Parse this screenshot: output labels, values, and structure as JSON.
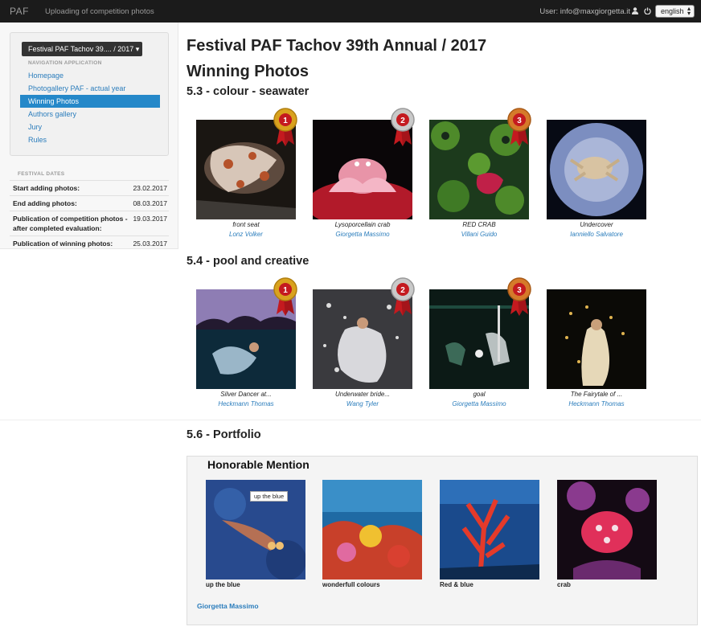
{
  "topbar": {
    "brand": "PAF",
    "app_title": "Uploading of competition photos",
    "user": "User: info@maxgiorgetta.it",
    "language": "english"
  },
  "nav": {
    "festival_button": "Festival PAF Tachov 39.... / 2017 ▾",
    "header": "NAVIGATION APPLICATION",
    "items": [
      {
        "label": "Homepage",
        "active": false
      },
      {
        "label": "Photogallery PAF - actual year",
        "active": false
      },
      {
        "label": "Winning Photos",
        "active": true
      },
      {
        "label": "Authors gallery",
        "active": false
      },
      {
        "label": "Jury",
        "active": false
      },
      {
        "label": "Rules",
        "active": false
      }
    ]
  },
  "dates": {
    "title": "FESTIVAL DATES",
    "rows": [
      {
        "label": "Start adding photos:",
        "value": "23.02.2017"
      },
      {
        "label": "End adding photos:",
        "value": "08.03.2017"
      },
      {
        "label": "Publication of competition photos - after completed evaluation:",
        "value": "19.03.2017"
      },
      {
        "label": "Publication of winning photos:",
        "value": "25.03.2017"
      }
    ]
  },
  "main": {
    "title": "Festival PAF Tachov 39th Annual / 2017",
    "subtitle": "Winning Photos",
    "sections": [
      {
        "heading": "5.3 - colour - seawater",
        "photos": [
          {
            "caption": "front seat",
            "author": "Lonz Volker",
            "medal": "1"
          },
          {
            "caption": "Lysoporcellain crab",
            "author": "Giorgetta Massimo",
            "medal": "2"
          },
          {
            "caption": "RED CRAB",
            "author": "Villani Guido",
            "medal": "3"
          },
          {
            "caption": "Undercover",
            "author": "Ianniello Salvatore",
            "medal": ""
          }
        ]
      },
      {
        "heading": "5.4 - pool and creative",
        "photos": [
          {
            "caption": "Silver Dancer at...",
            "author": "Heckmann Thomas",
            "medal": "1"
          },
          {
            "caption": "Underwater bride...",
            "author": "Wang Tyler",
            "medal": "2"
          },
          {
            "caption": "goal",
            "author": "Giorgetta Massimo",
            "medal": "3"
          },
          {
            "caption": "The Fairytale of ...",
            "author": "Heckmann Thomas",
            "medal": ""
          }
        ]
      }
    ],
    "portfolio": {
      "heading": "5.6 - Portfolio",
      "box_title": "Honorable Mention",
      "tooltip": "up the blue",
      "photos": [
        {
          "caption": "up the blue"
        },
        {
          "caption": "wonderfull colours"
        },
        {
          "caption": "Red & blue"
        },
        {
          "caption": "crab"
        }
      ],
      "author": "Giorgetta Massimo"
    }
  },
  "colors": {
    "link": "#2b7dbc",
    "nav_active": "#2588c9",
    "topbar": "#1b1b1b",
    "medal_gold": "#d9a21e",
    "medal_silver": "#b9b9b9",
    "medal_bronze": "#d57a2a",
    "ribbon": "#c41a1f"
  }
}
